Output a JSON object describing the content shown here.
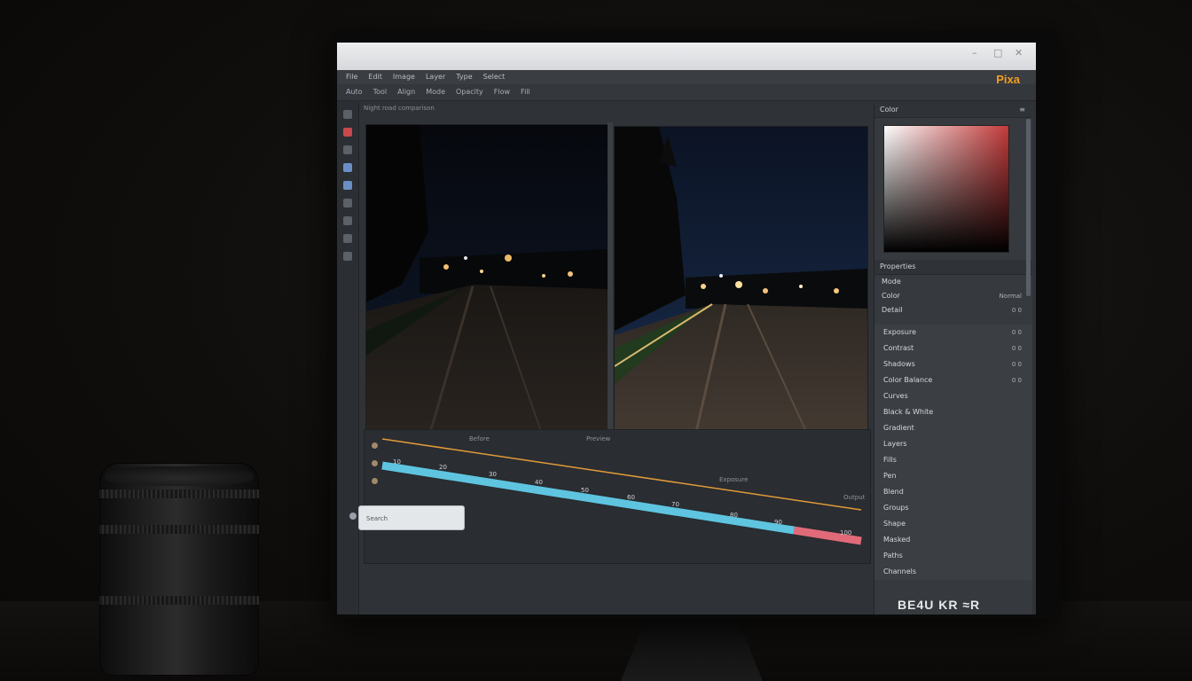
{
  "titlebar": {
    "controls": [
      "–",
      "□",
      "✕"
    ]
  },
  "menu": [
    "File",
    "Edit",
    "Image",
    "Layer",
    "Type",
    "Select"
  ],
  "toolbar": [
    "Auto",
    "Tool",
    "Align",
    "Mode",
    "Opacity",
    "Flow",
    "Fill"
  ],
  "brand": "Pixa",
  "document_label": "Night road comparison",
  "curves": {
    "header_left": "Before",
    "header_mid": "Preview",
    "header_right": "Exposure",
    "corner_label": "Output",
    "ticks": [
      "10",
      "20",
      "30",
      "40",
      "50",
      "60",
      "70",
      "80",
      "90",
      "100"
    ],
    "slider_value_fraction": 0.86
  },
  "status_box": "Search",
  "right_panel": {
    "color_header": "Color",
    "props_header": "Properties",
    "prop_rows": [
      {
        "label": "Mode",
        "value": ""
      },
      {
        "label": "Color",
        "value": "Normal"
      },
      {
        "label": "Detail",
        "value": "0 0"
      }
    ],
    "layers": [
      {
        "label": "Exposure",
        "value": "0 0"
      },
      {
        "label": "Contrast",
        "value": "0 0"
      },
      {
        "label": "Shadows",
        "value": "0 0"
      },
      {
        "label": "Color Balance",
        "value": "0 0"
      },
      {
        "label": "Curves",
        "value": ""
      },
      {
        "label": "Black & White",
        "value": ""
      },
      {
        "label": "Gradient",
        "value": ""
      },
      {
        "label": "Layers",
        "value": ""
      },
      {
        "label": "Fills",
        "value": ""
      },
      {
        "label": "Pen",
        "value": ""
      },
      {
        "label": "Blend",
        "value": ""
      },
      {
        "label": "Groups",
        "value": ""
      },
      {
        "label": "Shape",
        "value": ""
      },
      {
        "label": "Masked",
        "value": ""
      },
      {
        "label": "Paths",
        "value": ""
      },
      {
        "label": "Channels",
        "value": ""
      }
    ]
  },
  "bezel_text": "BE4U KR ≈R",
  "colors": {
    "accent": "#f0a020",
    "slider_blue": "#5ec4e0",
    "slider_red": "#e06a78",
    "curve_orange": "#e09a3a"
  }
}
